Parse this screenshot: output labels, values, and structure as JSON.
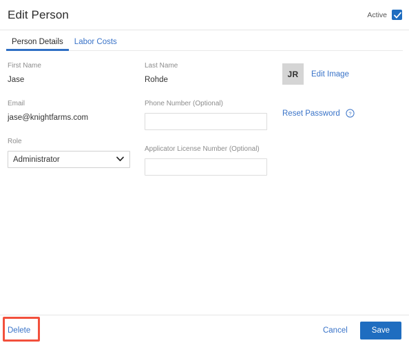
{
  "header": {
    "title": "Edit Person",
    "active_label": "Active",
    "active_checked": true
  },
  "tabs": [
    {
      "label": "Person Details",
      "active": true
    },
    {
      "label": "Labor Costs",
      "active": false
    }
  ],
  "form": {
    "first_name": {
      "label": "First Name",
      "value": "Jase"
    },
    "last_name": {
      "label": "Last Name",
      "value": "Rohde"
    },
    "email": {
      "label": "Email",
      "value": "jase@knightfarms.com"
    },
    "phone": {
      "label": "Phone Number (Optional)",
      "value": "",
      "placeholder": ""
    },
    "role": {
      "label": "Role",
      "value": "Administrator"
    },
    "applicator_license": {
      "label": "Applicator License Number (Optional)",
      "value": "",
      "placeholder": ""
    }
  },
  "profile": {
    "avatar_initials": "JR",
    "edit_image_label": "Edit Image",
    "reset_password_label": "Reset Password"
  },
  "footer": {
    "delete_label": "Delete",
    "cancel_label": "Cancel",
    "save_label": "Save"
  },
  "colors": {
    "accent_blue": "#1f6dc0",
    "link_blue": "#3973c8",
    "annotation_red": "#f2503c",
    "avatar_gray": "#d5d5d5"
  }
}
